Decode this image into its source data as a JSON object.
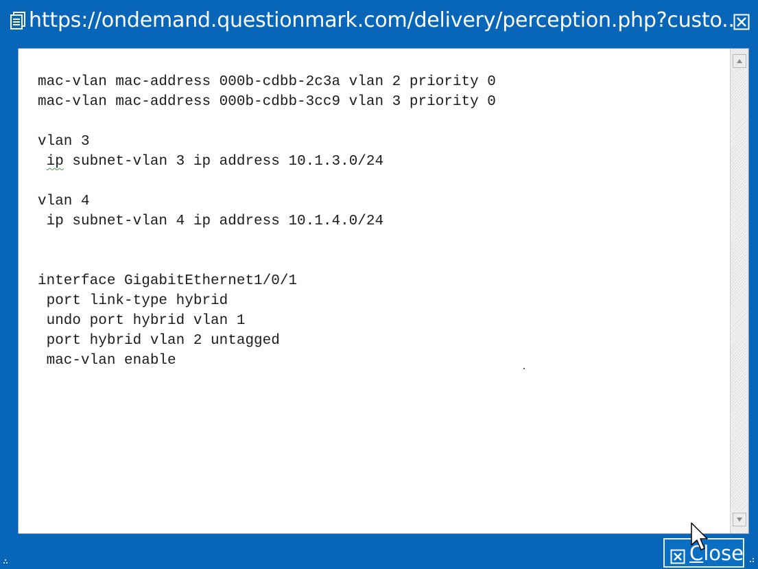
{
  "window": {
    "title": "https://ondemand.questionmark.com/delivery/perception.php?custo...",
    "title_icon": "page-icon",
    "close_icon": "close-box-icon"
  },
  "content": {
    "lines": [
      "mac-vlan mac-address 000b-cdbb-2c3a vlan 2 priority 0",
      "mac-vlan mac-address 000b-cdbb-3cc9 vlan 3 priority 0",
      "",
      "vlan 3",
      " ip subnet-vlan 3 ip address 10.1.3.0/24",
      "",
      "vlan 4",
      " ip subnet-vlan 4 ip address 10.1.4.0/24",
      "",
      "",
      "interface GigabitEthernet1/0/1",
      " port link-type hybrid",
      " undo port hybrid vlan 1",
      " port hybrid vlan 2 untagged",
      " mac-vlan enable"
    ],
    "spellcheck_word": "ip"
  },
  "footer": {
    "close_label": "Close",
    "close_icon": "close-box-icon"
  },
  "colors": {
    "frame_blue": "#0866b8",
    "content_bg": "#ffffff",
    "text": "#1c1c1c"
  }
}
